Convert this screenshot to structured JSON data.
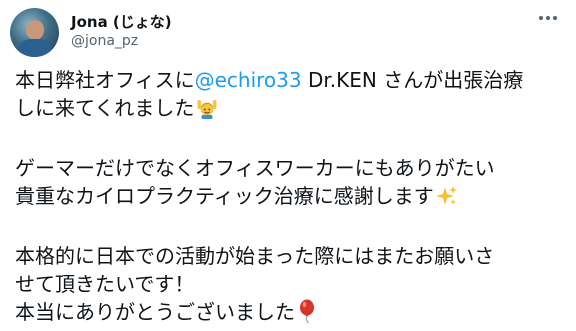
{
  "user": {
    "display_name": "Jona (じょな)",
    "handle": "@jona_pz"
  },
  "icons": {
    "more": "more-horizontal-icon",
    "emoji_1": "person-raising-hands-emoji",
    "emoji_2": "sparkles-emoji",
    "emoji_3": "balloon-emoji"
  },
  "tweet": {
    "para1_line1_prefix": "本日弊社オフィスに",
    "mention": "@echiro33",
    "para1_line1_suffix": " Dr.KEN さんが出張治療",
    "para1_line2": "しに来てくれました",
    "para2_line1": "ゲーマーだけでなくオフィスワーカーにもありがたい",
    "para2_line2": "貴重なカイロプラクティック治療に感謝します",
    "para3_line1": "本格的に日本での活動が始まった際にはまたお願いさ",
    "para3_line2": "せて頂きたいです！",
    "para3_line3": "本当にありがとうございました"
  },
  "colors": {
    "link": "#1d9bf0",
    "text": "#0f1419",
    "secondary": "#536471"
  }
}
